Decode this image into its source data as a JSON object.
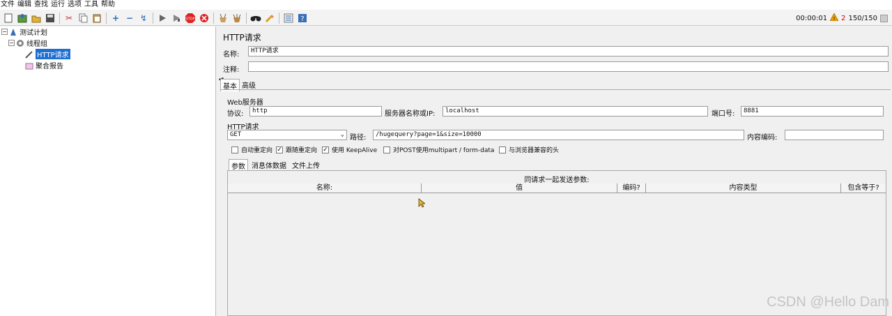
{
  "menu": [
    "文件",
    "编辑",
    "查找",
    "运行",
    "选项",
    "工具",
    "帮助"
  ],
  "toolbar": {
    "icons": [
      "new-icon",
      "templates-icon",
      "open-icon",
      "save-icon",
      "cut-icon",
      "copy-icon",
      "paste-icon",
      "expand-icon",
      "collapse-icon",
      "toggle-icon",
      "start-icon",
      "start-no-pause-icon",
      "stop-icon",
      "shutdown-icon",
      "clear-icon",
      "clear-all-icon",
      "search-icon",
      "reset-search-icon",
      "function-helper-icon",
      "help-icon"
    ],
    "elapsed": "00:00:01",
    "warning_count": "2",
    "threads": "150/150"
  },
  "tree": {
    "plan": "测试计划",
    "thread_group": "线程组",
    "http_request": "HTTP请求",
    "report": "聚合报告"
  },
  "panel": {
    "title": "HTTP请求",
    "name_label": "名称:",
    "name_value": "HTTP请求",
    "comment_label": "注释:",
    "comment_value": "",
    "tabs": [
      "基本",
      "高级"
    ],
    "web_server_label": "Web服务器",
    "protocol_label": "协议:",
    "protocol_value": "http",
    "server_label": "服务器名称或IP:",
    "server_value": "localhost",
    "port_label": "端口号:",
    "port_value": "8881",
    "http_request_label": "HTTP请求",
    "method_value": "GET",
    "path_label": "路径:",
    "path_value": "/hugequery?page=1&size=10000",
    "encoding_label": "内容编码:",
    "encoding_value": "",
    "checkboxes": [
      {
        "label": "自动重定向",
        "checked": false
      },
      {
        "label": "跟随重定向",
        "checked": true
      },
      {
        "label": "使用 KeepAlive",
        "checked": true
      },
      {
        "label": "对POST使用multipart / form-data",
        "checked": false
      },
      {
        "label": "与浏览器兼容的头",
        "checked": false
      }
    ],
    "subtabs": [
      "参数",
      "消息体数据",
      "文件上传"
    ],
    "params_caption": "同请求一起发送参数:",
    "columns": [
      "名称:",
      "值",
      "编码?",
      "内容类型",
      "包含等于?"
    ]
  },
  "watermark": "CSDN @Hello Dam",
  "colors": {
    "selection": "#1f6fd1",
    "warning": "#e8a000"
  }
}
